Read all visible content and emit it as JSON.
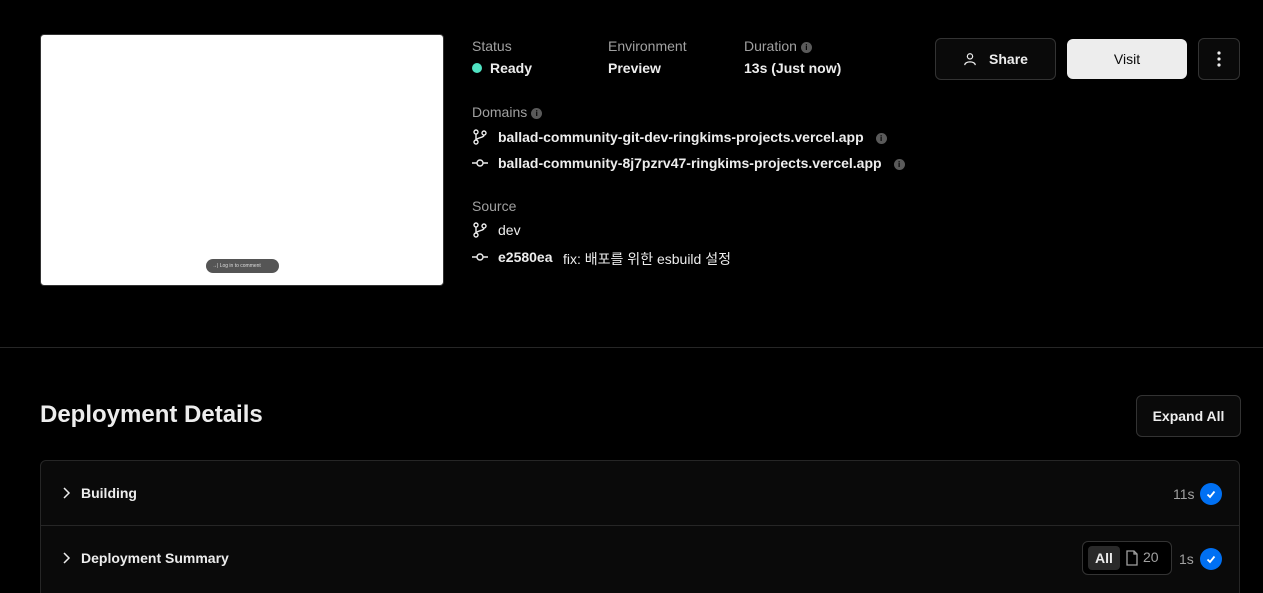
{
  "preview": {
    "comment_pill": "→| Log in to comment"
  },
  "status": {
    "label": "Status",
    "value": "Ready",
    "color": "#50e3c2"
  },
  "environment": {
    "label": "Environment",
    "value": "Preview"
  },
  "duration": {
    "label": "Duration",
    "value": "13s (Just now)"
  },
  "domains": {
    "label": "Domains",
    "items": [
      {
        "icon": "git-branch-icon",
        "url": "ballad-community-git-dev-ringkims-projects.vercel.app"
      },
      {
        "icon": "git-commit-icon",
        "url": "ballad-community-8j7pzrv47-ringkims-projects.vercel.app"
      }
    ]
  },
  "source": {
    "label": "Source",
    "branch": "dev",
    "commit_hash": "e2580ea",
    "commit_message": "fix: 배포를 위한 esbuild 설정"
  },
  "actions": {
    "share": "Share",
    "visit": "Visit",
    "more": "more-vertical-icon"
  },
  "details": {
    "title": "Deployment Details",
    "expand_all": "Expand All",
    "rows": [
      {
        "label": "Building",
        "time": "11s",
        "status": "success"
      },
      {
        "label": "Deployment Summary",
        "time": "1s",
        "status": "success",
        "filter_all": "All",
        "file_count": "20"
      }
    ]
  },
  "colors": {
    "accent": "#0070f3",
    "ready": "#50e3c2",
    "background": "#000000"
  }
}
